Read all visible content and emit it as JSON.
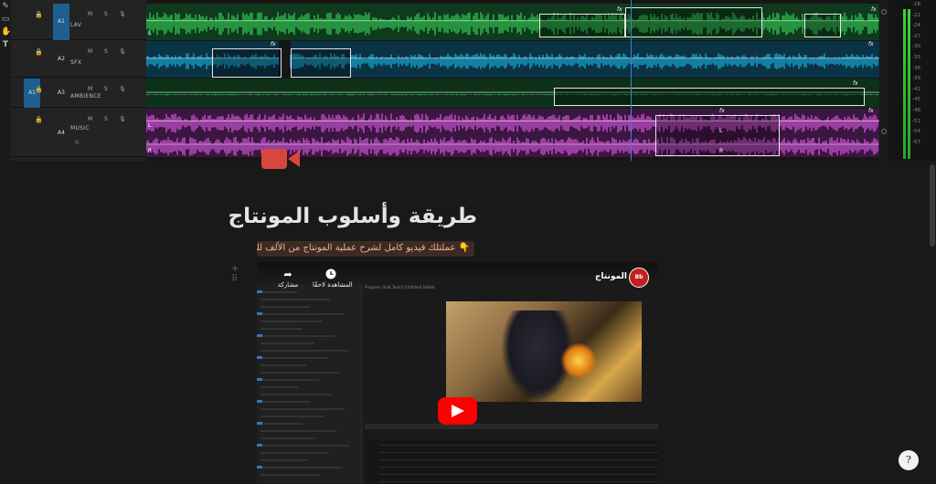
{
  "timeline": {
    "tracks": [
      {
        "source": "",
        "target": "A1",
        "name": "LAV",
        "color": "#2dbb4e",
        "source_on": false,
        "target_on": true
      },
      {
        "source": "",
        "target": "A2",
        "name": "SFX",
        "color": "#1aa0c8",
        "source_on": false,
        "target_on": false
      },
      {
        "source": "A1",
        "target": "A3",
        "name": "AMBIENCE",
        "color": "#2dbb4e",
        "source_on": true,
        "target_on": false
      },
      {
        "source": "",
        "target": "A4",
        "name": "MUSIC",
        "color": "#c24fc9",
        "source_on": false,
        "target_on": false
      }
    ],
    "track_buttons": {
      "mute": "M",
      "solo": "S",
      "lock": "🔒",
      "voice": "🎙"
    },
    "extra_row": "0.",
    "fx_label": "fx",
    "clip_labels": {
      "left": "L",
      "right": "R"
    },
    "meter_db": [
      "-18",
      "-21",
      "-24",
      "-27",
      "-30",
      "-33",
      "-36",
      "-39",
      "-42",
      "-45",
      "-48",
      "-51",
      "-54",
      "-57"
    ],
    "colors": {
      "lav": "#2dbb4e",
      "sfx": "#1aa0c8",
      "music": "#c24fc9",
      "meter": "#3cd43c",
      "playhead": "#4a7ad9"
    }
  },
  "page": {
    "title": "طريقة وأسلوب المونتاج",
    "subtitle_emoji": "👇",
    "subtitle": "عملتلك فيديو كامل لشرح عملية المونتاج من الألف للياء",
    "block_handle": "+ ⠿"
  },
  "video": {
    "channel_name": "المونتاج",
    "channel_logo_text": "Bb",
    "share_label": "مشاركة",
    "share_icon": "share-icon",
    "watch_later_label": "المشاهدة لاحقًا",
    "watch_later_icon": "clock-icon",
    "play_icon": "youtube-play-icon",
    "app_tabs": "Program: [Edit Team]  [Untitled] Edited"
  },
  "help": {
    "label": "?"
  }
}
